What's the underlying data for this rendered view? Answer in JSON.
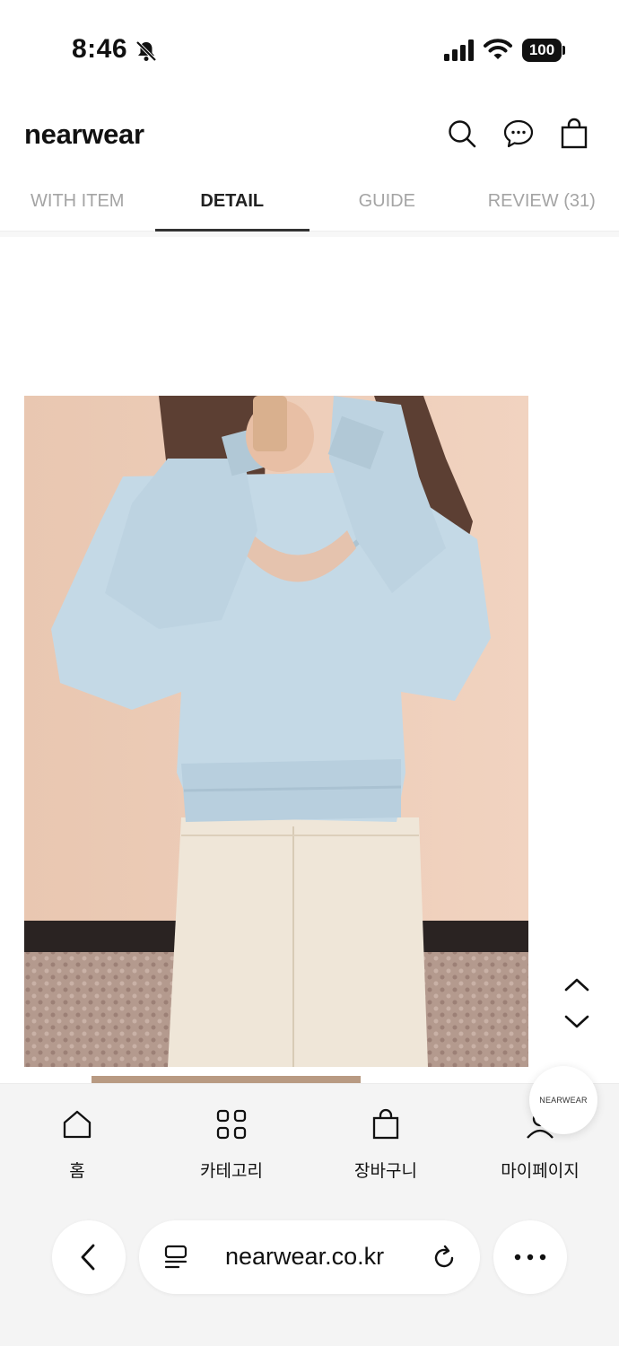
{
  "status": {
    "time": "8:46",
    "battery": "100"
  },
  "header": {
    "brand": "nearwear"
  },
  "tabs": [
    {
      "label": "WITH ITEM",
      "active": false
    },
    {
      "label": "DETAIL",
      "active": true
    },
    {
      "label": "GUIDE",
      "active": false
    },
    {
      "label": "REVIEW (31)",
      "active": false
    }
  ],
  "bottom_nav": [
    {
      "label": "홈",
      "icon": "home-icon"
    },
    {
      "label": "카테고리",
      "icon": "grid-icon"
    },
    {
      "label": "장바구니",
      "icon": "bag-icon"
    },
    {
      "label": "마이페이지",
      "icon": "person-icon"
    }
  ],
  "float_badge": "NEARWEAR",
  "browser": {
    "url": "nearwear.co.kr"
  },
  "colors": {
    "active_tab": "#222222",
    "inactive_tab": "#a4a4a4",
    "nav_bg": "#f4f4f4"
  }
}
